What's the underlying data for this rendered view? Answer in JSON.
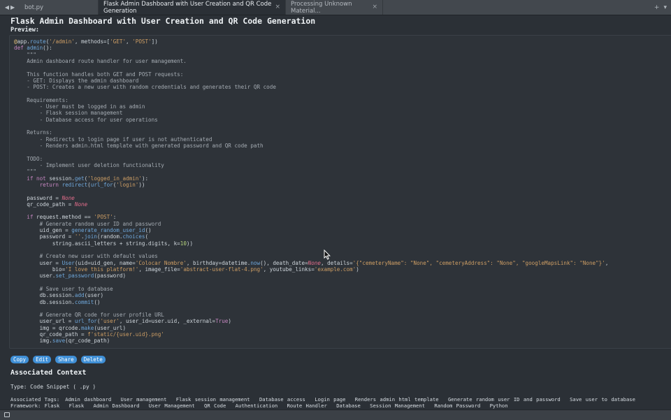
{
  "tabs": [
    {
      "label": "bot.py",
      "active": false
    },
    {
      "label": "Flask Admin Dashboard with User Creation and QR Code Generation",
      "active": true
    },
    {
      "label": "Processing Unknown Material...",
      "active": false
    }
  ],
  "page": {
    "title": "Flask Admin Dashboard with User Creation and QR Code Generation",
    "preview_label": "Preview:"
  },
  "actions": {
    "copy": "Copy",
    "edit": "Edit",
    "share": "Share",
    "delete": "Delete"
  },
  "context": {
    "title": "Associated Context",
    "type_line": "Type: Code Snippet ( .py )",
    "tags_label": "Associated Tags:",
    "tags": [
      "Admin dashboard",
      "User management",
      "Flask session management",
      "Database access",
      "Login page",
      "Renders admin html template",
      "Generate random user ID and password",
      "Save user to database",
      "Framework: Flask",
      "Flask",
      "Admin Dashboard",
      "User Management",
      "QR Code",
      "Authentication",
      "Route Handler",
      "Database",
      "Session Management",
      "Random Password",
      "Python"
    ]
  },
  "code_lines": [
    "@app.route('/admin', methods=['GET', 'POST'])",
    "def admin():",
    "    \"\"\"",
    "    Admin dashboard route handler for user management.",
    "",
    "    This function handles both GET and POST requests:",
    "    - GET: Displays the admin dashboard",
    "    - POST: Creates a new user with random credentials and generates their QR code",
    "",
    "    Requirements:",
    "        - User must be logged in as admin",
    "        - Flask session management",
    "        - Database access for user operations",
    "",
    "    Returns:",
    "        - Redirects to login page if user is not authenticated",
    "        - Renders admin.html template with generated password and QR code path",
    "",
    "    TODO:",
    "        - Implement user deletion functionality",
    "    \"\"\"",
    "    if not session.get('logged_in_admin'):",
    "        return redirect(url_for('login'))",
    "",
    "    password = None",
    "    qr_code_path = None",
    "",
    "    if request.method == 'POST':",
    "        # Generate random user ID and password",
    "        uid_gen = generate_random_user_id()",
    "        password = ''.join(random.choices(",
    "            string.ascii_letters + string.digits, k=10))",
    "",
    "        # Create new user with default values",
    "        user = User(uid=uid_gen, name='Colocar Nombre', birthday=datetime.now(), death_date=None, details='{\"cemeteryName\": \"None\", \"cemeteryAddress\": \"None\", \"googleMapsLink\": \"None\"}',",
    "            bio='I love this platform!', image_file='abstract-user-flat-4.png', youtube_links='example.com')",
    "        user.set_password(password)",
    "",
    "        # Save user to database",
    "        db.session.add(user)",
    "        db.session.commit()",
    "",
    "        # Generate QR code for user profile URL",
    "        user_url = url_for('user', user_id=user.uid, _external=True)",
    "        img = qrcode.make(user_url)",
    "        qr_code_path = f'static/{user.uid}.png'",
    "        img.save(qr_code_path)"
  ],
  "colors": {
    "background": "#2b3036",
    "accent_button": "#3f8fd6",
    "keyword": "#c586c0",
    "function": "#6fa8dc",
    "string": "#ce9e64",
    "none_literal": "#e06c8a"
  },
  "icons": {
    "back": "chevron-left-icon",
    "forward": "chevron-right-icon",
    "new_tab": "plus-icon",
    "tab_menu": "chevron-down-icon",
    "cursor": "mouse-pointer-icon",
    "status": "window-icon"
  }
}
